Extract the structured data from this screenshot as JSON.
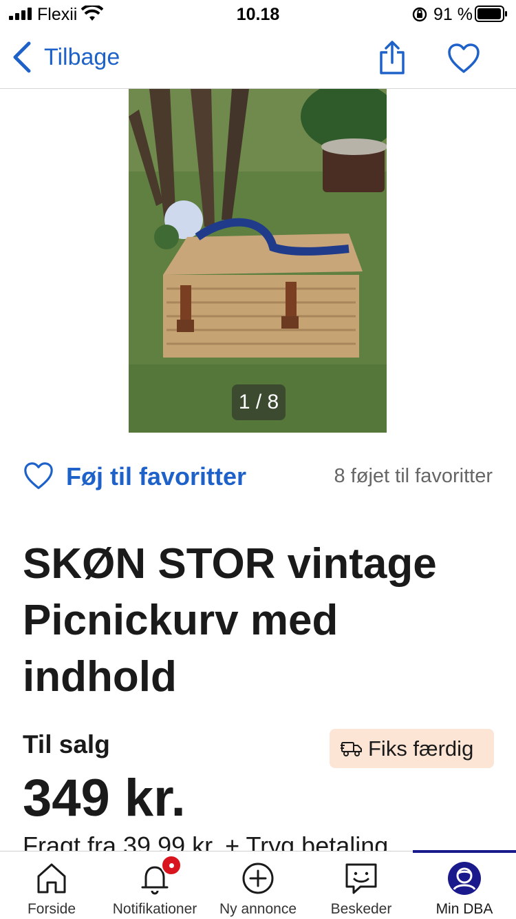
{
  "status_bar": {
    "carrier": "Flexii",
    "time": "10.18",
    "battery": "91 %"
  },
  "nav": {
    "back_label": "Tilbage"
  },
  "gallery": {
    "counter": "1 / 8"
  },
  "favorite": {
    "label": "Føj til favoritter",
    "count_text": "8 føjet til favoritter"
  },
  "listing": {
    "title": "SKØN STOR vintage Picnickurv med indhold",
    "sale_type": "Til salg",
    "badge": "Fiks færdig",
    "price": "349 kr.",
    "shipping": "Fragt fra 39,99 kr. + Tryg betaling"
  },
  "tabs": [
    {
      "label": "Forside",
      "icon": "home-icon"
    },
    {
      "label": "Notifikationer",
      "icon": "bell-icon"
    },
    {
      "label": "Ny annonce",
      "icon": "plus-circle-icon"
    },
    {
      "label": "Beskeder",
      "icon": "chat-icon"
    },
    {
      "label": "Min DBA",
      "icon": "profile-icon"
    }
  ],
  "colors": {
    "accent": "#1e62c9",
    "badge_bg": "#fde5d6",
    "notification": "#d8151f",
    "active_tab": "#1a1a8c"
  }
}
